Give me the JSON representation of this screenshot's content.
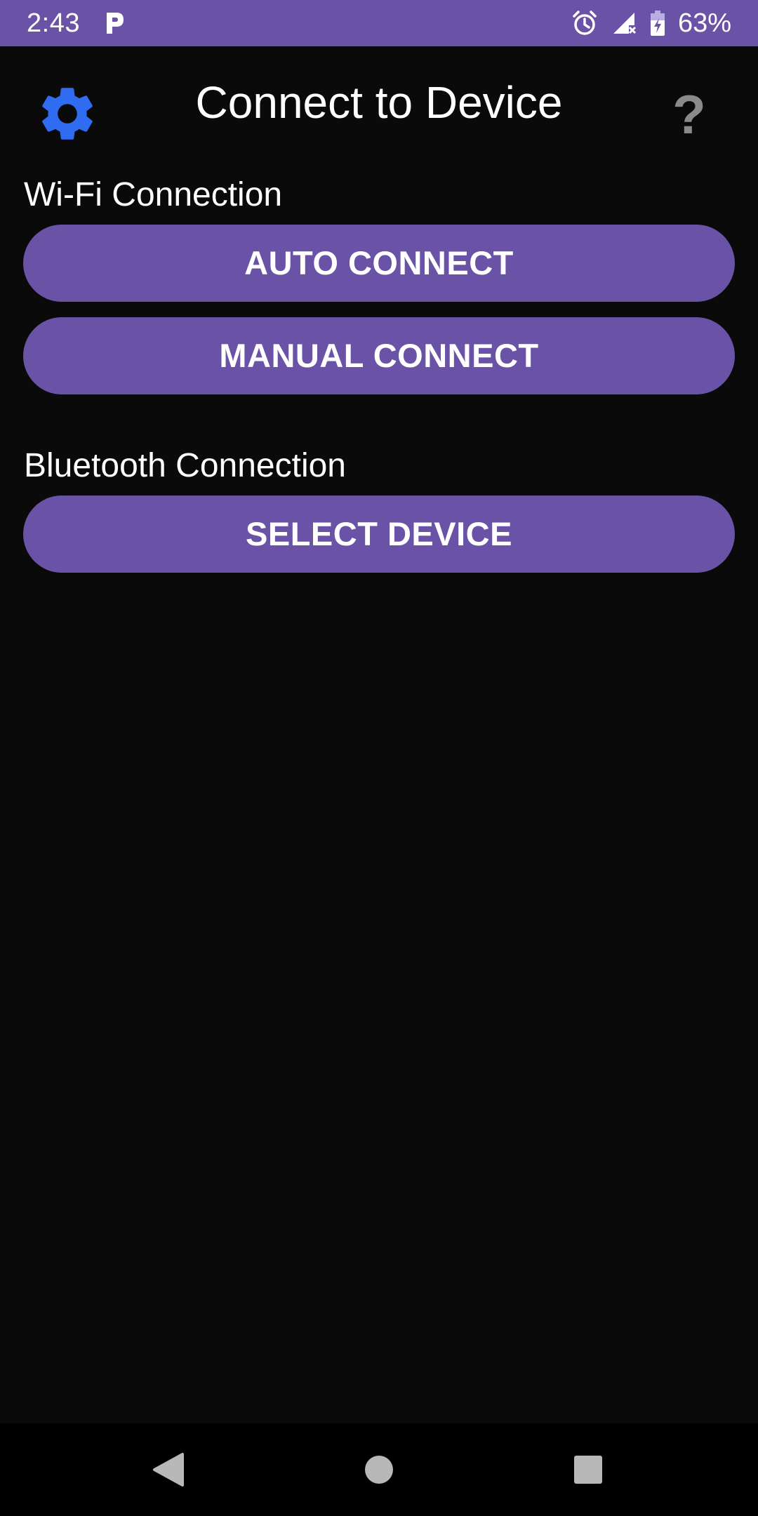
{
  "status_bar": {
    "time": "2:43",
    "battery_percent": "63%",
    "icons": [
      "parking-p-icon",
      "alarm-icon",
      "signal-no-service-icon",
      "battery-charging-icon"
    ],
    "background_color": "#6a52a6"
  },
  "header": {
    "title": "Connect to Device",
    "settings_icon": "gear-icon",
    "settings_icon_color": "#2f6cf2",
    "help_label": "?"
  },
  "wifi_section": {
    "label": "Wi-Fi Connection",
    "auto_connect_label": "AUTO CONNECT",
    "manual_connect_label": "MANUAL CONNECT"
  },
  "bluetooth_section": {
    "label": "Bluetooth Connection",
    "select_device_label": "SELECT DEVICE"
  },
  "theme": {
    "button_color": "#6a52a6",
    "background_color": "#0a0a0a"
  },
  "nav_bar": {
    "icons": [
      "back-icon",
      "home-icon",
      "recents-icon"
    ]
  }
}
